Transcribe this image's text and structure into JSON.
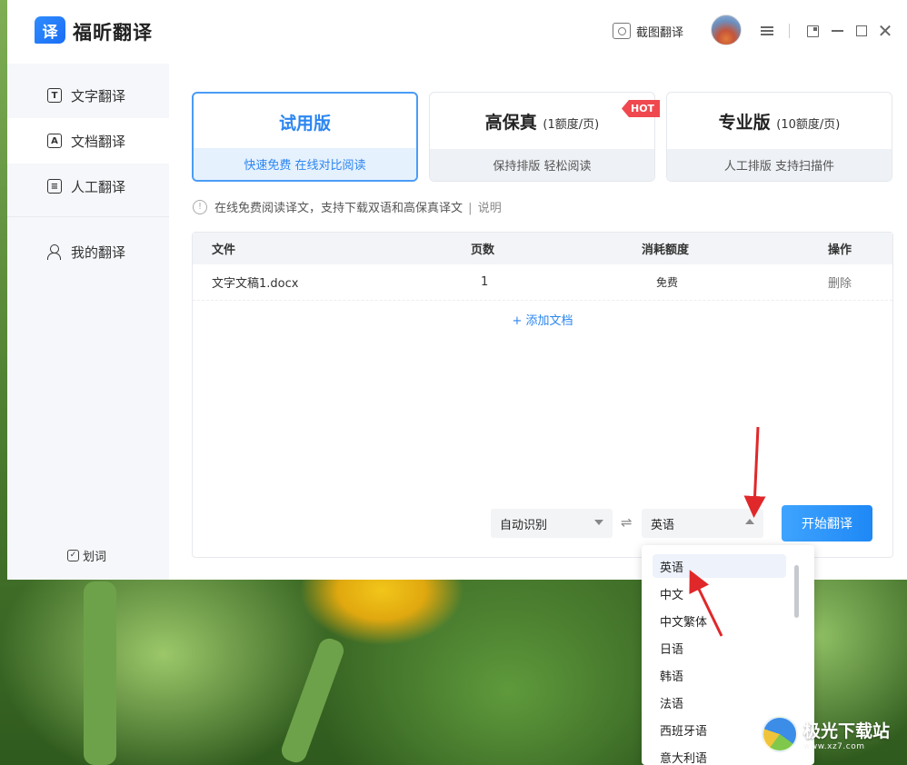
{
  "app": {
    "logo_text": "译",
    "name": "福昕翻译",
    "screenshot_label": "截图翻译"
  },
  "sidebar": {
    "items": [
      {
        "label": "文字翻译",
        "icon": "text-translate-icon",
        "icon_glyph": "T"
      },
      {
        "label": "文档翻译",
        "icon": "doc-translate-icon",
        "icon_glyph": "A"
      },
      {
        "label": "人工翻译",
        "icon": "human-translate-icon",
        "icon_glyph": "≡"
      },
      {
        "label": "我的翻译",
        "icon": "user-icon"
      }
    ],
    "huaci_label": "划词",
    "huaci_check": "✓"
  },
  "plans": [
    {
      "title": "试用版",
      "quota": "",
      "subtitle": "快速免费 在线对比阅读",
      "active": true
    },
    {
      "title": "高保真",
      "quota": "(1额度/页)",
      "subtitle": "保持排版 轻松阅读",
      "badge": "HOT"
    },
    {
      "title": "专业版",
      "quota": "(10额度/页)",
      "subtitle": "人工排版 支持扫描件"
    }
  ],
  "notice": {
    "icon": "!",
    "text": "在线免费阅读译文，支持下载双语和高保真译文",
    "sep": "|",
    "link": "说明"
  },
  "table": {
    "headers": {
      "file": "文件",
      "pages": "页数",
      "cost": "消耗额度",
      "action": "操作"
    },
    "rows": [
      {
        "file": "文字文稿1.docx",
        "pages": "1",
        "cost": "免费",
        "action": "删除"
      }
    ],
    "add_label": "+ 添加文档"
  },
  "translate_bar": {
    "source_lang": "自动识别",
    "swap_glyph": "⇌",
    "target_lang": "英语",
    "start_label": "开始翻译"
  },
  "language_dropdown": {
    "selected": "英语",
    "options": [
      "英语",
      "中文",
      "中文繁体",
      "日语",
      "韩语",
      "法语",
      "西班牙语",
      "意大利语"
    ]
  },
  "watermark": {
    "text": "极光下载站",
    "sub": "www.xz7.com"
  },
  "colors": {
    "accent": "#2b86f0",
    "hot_badge": "#f0484f",
    "annotation_arrow": "#e0282a"
  }
}
